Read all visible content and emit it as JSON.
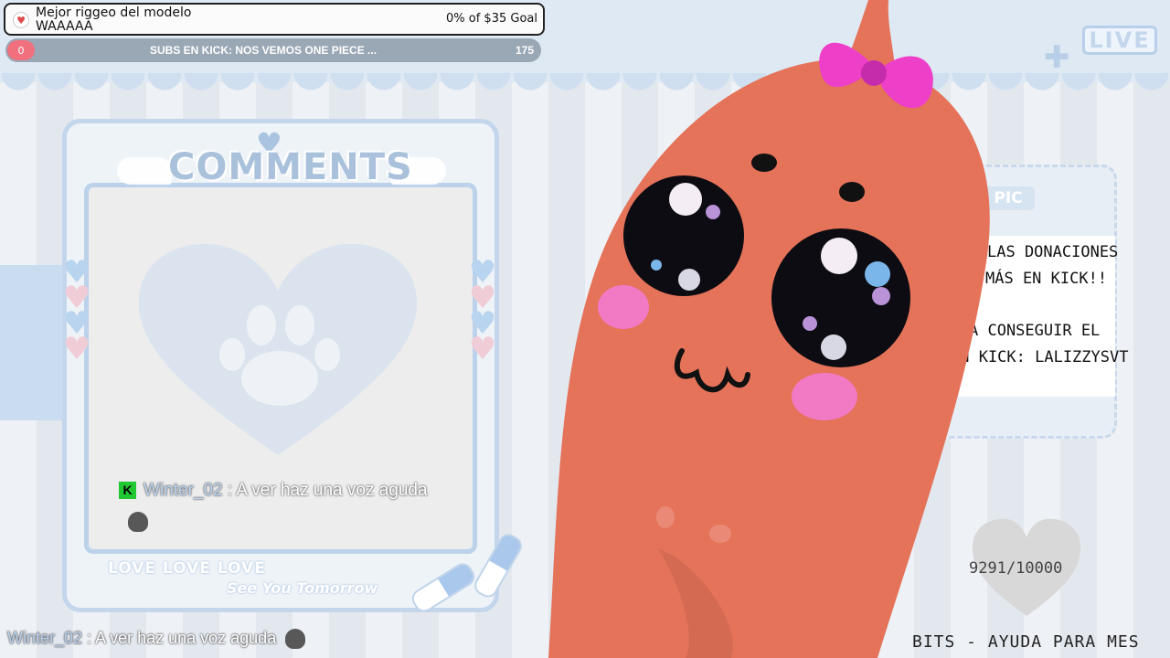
{
  "goal": {
    "title_line1": "Mejor riggeo del modelo",
    "title_line2": "WAAAAA",
    "progress_text": "0% of $35 Goal",
    "progress_fraction": 0
  },
  "subs_bar": {
    "current": "0",
    "text": "SUBS EN KICK: NOS VEMOS ONE PIECE ...",
    "target": "175"
  },
  "live_label": "LIVE",
  "comments": {
    "title": "COMMENTS",
    "messages": [
      {
        "platform_icon": "kick-icon",
        "platform_letter": "K",
        "user": "Winter_02",
        "separator": " : ",
        "text": "A ver haz una voz aguda",
        "emote": "skull-emote"
      }
    ],
    "footer_love": "LOVE LOVE LOVE",
    "footer_tomorrow": "See You Tomorrow"
  },
  "topic": {
    "tag": "PIC",
    "lines": [
      "LAS DONACIONES",
      "MÁS EN KICK!!",
      "",
      "A CONSEGUIR EL",
      "EN KICK: LALIZZYSVT"
    ]
  },
  "heart_counter": "9291/10000",
  "bits_label": "BITS - AYUDA PARA MES",
  "ticker": {
    "user": "Winter_02",
    "separator": " : ",
    "text": "A ver haz una voz aguda"
  },
  "colors": {
    "accent_blue": "#b9cfe7",
    "accent_pink": "#f0ccd6",
    "sausage": "#e4735a",
    "bow": "#ee3fc8",
    "kick_green": "#22c832"
  }
}
